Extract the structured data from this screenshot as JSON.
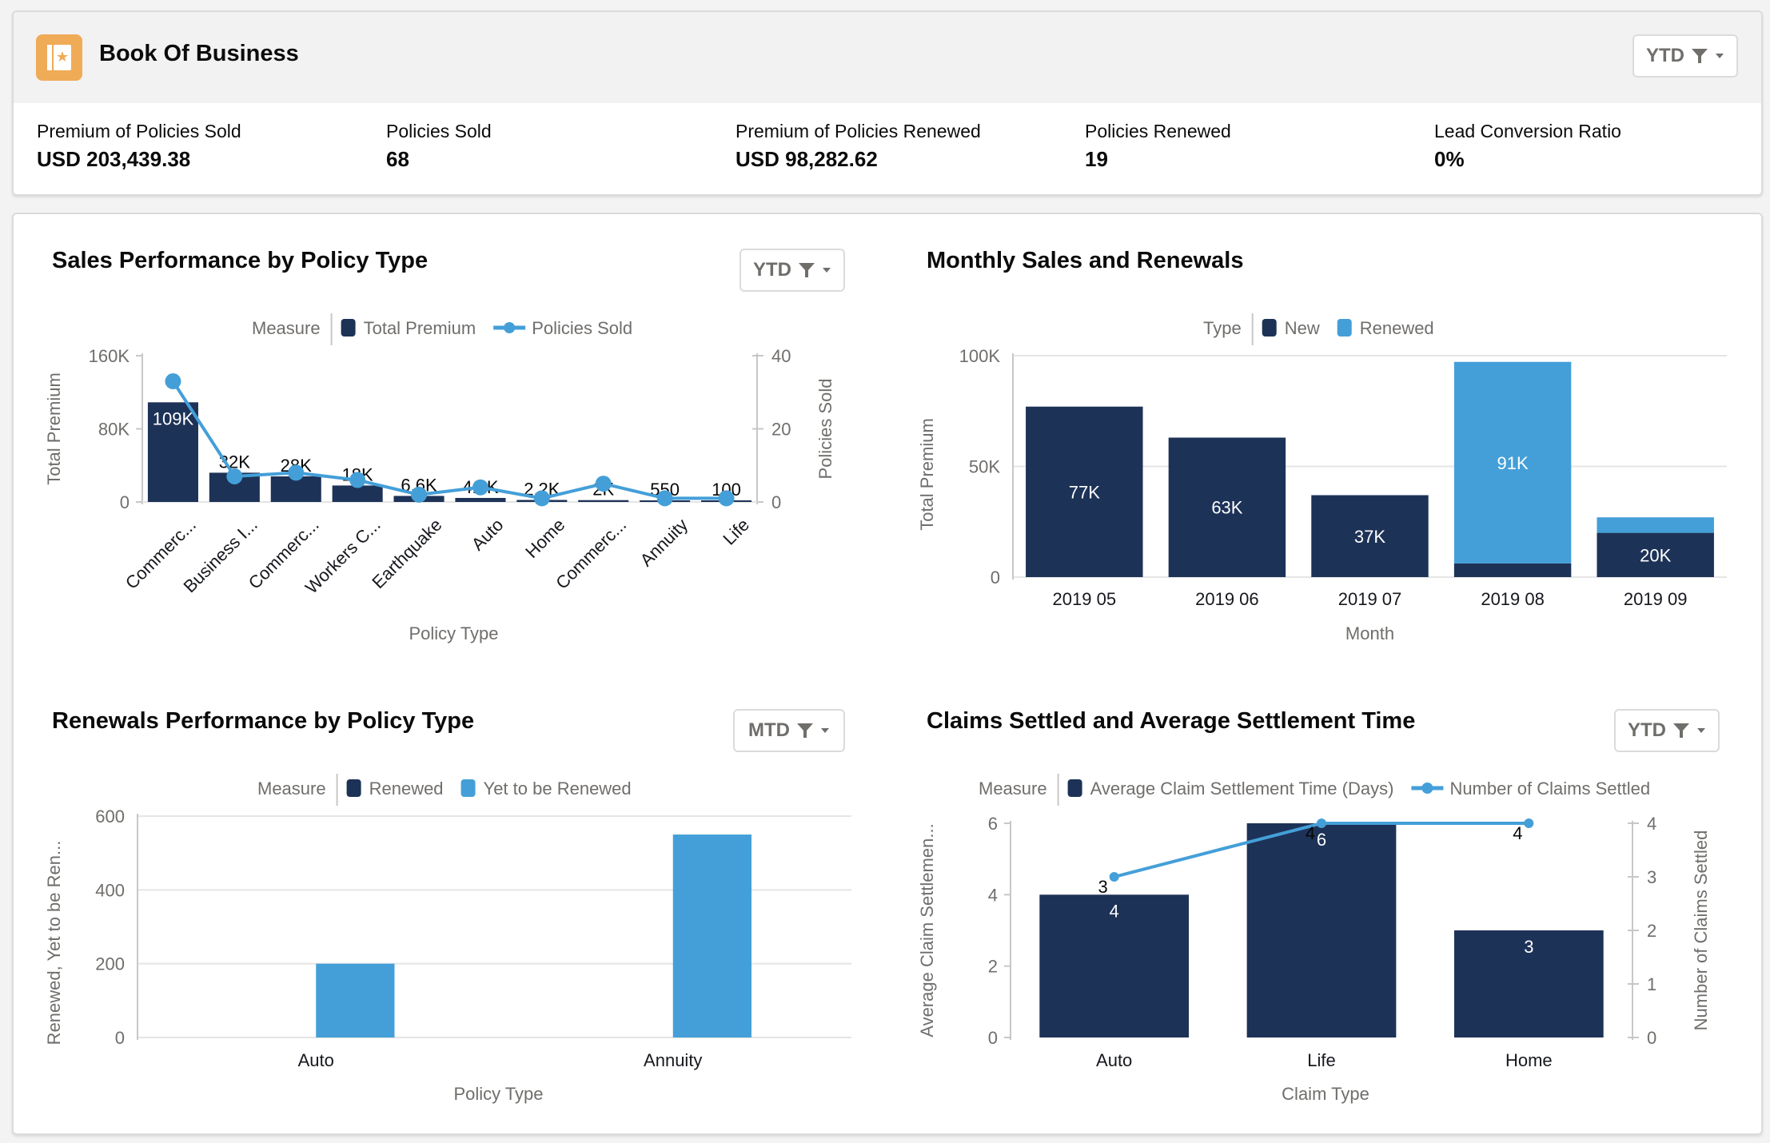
{
  "header": {
    "title": "Book Of Business",
    "icon": "book-star-icon",
    "filter_label": "YTD"
  },
  "kpis": [
    {
      "label": "Premium of Policies Sold",
      "value": "USD 203,439.38"
    },
    {
      "label": "Policies Sold",
      "value": "68"
    },
    {
      "label": "Premium of Policies Renewed",
      "value": "USD 98,282.62"
    },
    {
      "label": "Policies Renewed",
      "value": "19"
    },
    {
      "label": "Lead Conversion Ratio",
      "value": "0%"
    }
  ],
  "colors": {
    "dark_navy": "#1d3257",
    "light_blue": "#449fd8",
    "icon_orange": "#f0ab57",
    "grid": "#e5e5e5",
    "axis_text": "#706e6b"
  },
  "panels": {
    "sales": {
      "title": "Sales Performance by Policy Type",
      "filter_label": "YTD"
    },
    "monthly": {
      "title": "Monthly Sales and Renewals"
    },
    "renewals": {
      "title": "Renewals Performance by Policy Type",
      "filter_label": "MTD"
    },
    "claims": {
      "title": "Claims Settled and Average Settlement Time",
      "filter_label": "YTD"
    }
  },
  "chart_data": [
    {
      "id": "sales",
      "type": "bar",
      "title": "Sales Performance by Policy Type",
      "legend_title": "Measure",
      "legend_position": "top",
      "categories": [
        "Commerc...",
        "Business I...",
        "Commerc...",
        "Workers C...",
        "Earthquake",
        "Auto",
        "Home",
        "Commerc...",
        "Annuity",
        "Life"
      ],
      "series": [
        {
          "name": "Total Premium",
          "kind": "bar",
          "axis": "left",
          "color": "#1d3257",
          "values": [
            109000,
            32000,
            28000,
            18000,
            6600,
            4400,
            2200,
            2000,
            550,
            100
          ],
          "labels": [
            "109K",
            "32K",
            "28K",
            "18K",
            "6.6K",
            "4.4K",
            "2.2K",
            "2K",
            "550",
            "100"
          ]
        },
        {
          "name": "Policies Sold",
          "kind": "line",
          "axis": "right",
          "color": "#449fd8",
          "values": [
            33,
            7,
            8,
            6,
            2,
            4,
            1,
            5,
            1,
            1
          ]
        }
      ],
      "xlabel": "Policy Type",
      "ylabel": "Total Premium",
      "y2label": "Policies Sold",
      "ylim": [
        0,
        160000
      ],
      "yticks": [
        "0",
        "80K",
        "160K"
      ],
      "y2lim": [
        0,
        40
      ],
      "y2ticks": [
        "0",
        "20",
        "40"
      ],
      "grid": false
    },
    {
      "id": "monthly",
      "type": "bar",
      "stacked": true,
      "title": "Monthly Sales and Renewals",
      "legend_title": "Type",
      "legend_position": "top",
      "categories": [
        "2019 05",
        "2019 06",
        "2019 07",
        "2019 08",
        "2019 09"
      ],
      "series": [
        {
          "name": "New",
          "color": "#1d3257",
          "values": [
            77000,
            63000,
            37000,
            6200,
            20000
          ],
          "labels": [
            "77K",
            "63K",
            "37K",
            "",
            "20K"
          ]
        },
        {
          "name": "Renewed",
          "color": "#449fd8",
          "values": [
            0,
            0,
            0,
            91000,
            7000
          ],
          "labels": [
            "",
            "",
            "",
            "91K",
            ""
          ]
        }
      ],
      "xlabel": "Month",
      "ylabel": "Total Premium",
      "ylim": [
        0,
        100000
      ],
      "yticks": [
        "0",
        "50K",
        "100K"
      ],
      "grid": true
    },
    {
      "id": "renewals",
      "type": "bar",
      "title": "Renewals Performance by Policy Type",
      "legend_title": "Measure",
      "legend_position": "top",
      "categories": [
        "Auto",
        "Annuity"
      ],
      "series": [
        {
          "name": "Renewed",
          "color": "#1d3257",
          "values": [
            0,
            0
          ]
        },
        {
          "name": "Yet to be Renewed",
          "color": "#449fd8",
          "values": [
            200,
            550
          ]
        }
      ],
      "xlabel": "Policy Type",
      "ylabel": "Renewed, Yet to be Ren...",
      "ylim": [
        0,
        600
      ],
      "yticks": [
        "0",
        "200",
        "400",
        "600"
      ],
      "grid": true
    },
    {
      "id": "claims",
      "type": "bar",
      "title": "Claims Settled and Average Settlement Time",
      "legend_title": "Measure",
      "legend_position": "top",
      "categories": [
        "Auto",
        "Life",
        "Home"
      ],
      "series": [
        {
          "name": "Average Claim Settlement Time (Days)",
          "kind": "bar",
          "axis": "left",
          "color": "#1d3257",
          "values": [
            4,
            6,
            3
          ],
          "labels": [
            "4",
            "6",
            "3"
          ]
        },
        {
          "name": "Number of Claims Settled",
          "kind": "line",
          "axis": "right",
          "color": "#449fd8",
          "values": [
            3,
            4,
            4
          ],
          "labels": [
            "3",
            "4",
            "4"
          ]
        }
      ],
      "xlabel": "Claim Type",
      "ylabel": "Average Claim Settlemen...",
      "y2label": "Number of Claims Settled",
      "ylim": [
        0,
        6
      ],
      "yticks": [
        "0",
        "2",
        "4",
        "6"
      ],
      "y2lim": [
        0,
        4
      ],
      "y2ticks": [
        "0",
        "1",
        "2",
        "3",
        "4"
      ],
      "grid": false
    }
  ]
}
